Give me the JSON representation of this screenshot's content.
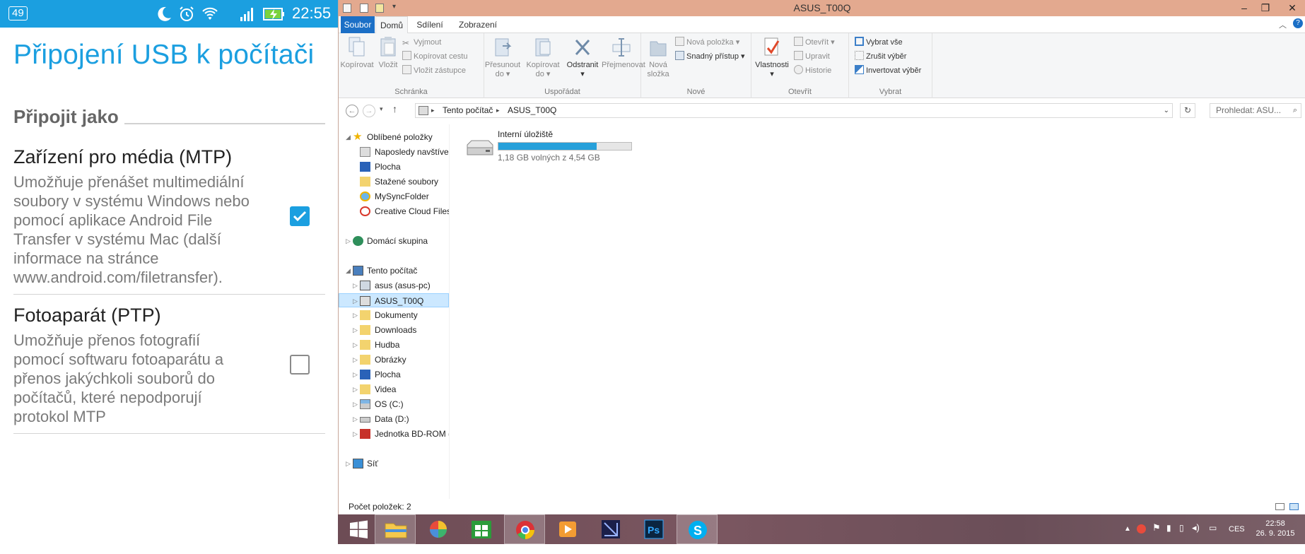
{
  "android": {
    "status_badge": "49",
    "time": "22:55",
    "title": "Připojení USB k počítači",
    "section": "Připojit jako",
    "options": [
      {
        "title": "Zařízení pro média (MTP)",
        "desc_lines": [
          "Umožňuje přenášet multimediální",
          "soubory v systému Windows nebo",
          "pomocí aplikace Android File",
          "Transfer v systému Mac (další",
          "informace na stránce",
          "www.android.com/filetransfer)."
        ],
        "checked": true
      },
      {
        "title": "Fotoaparát (PTP)",
        "desc_lines": [
          "Umožňuje přenos fotografií",
          "pomocí softwaru fotoaparátu a",
          "přenos jakýchkoli souborů do",
          "počítačů, které nepodporují",
          "protokol MTP"
        ],
        "checked": false
      }
    ],
    "colors": {
      "accent": "#1b9fe0"
    }
  },
  "explorer": {
    "window_title": "ASUS_T00Q",
    "tabs": [
      "Soubor",
      "Domů",
      "Sdílení",
      "Zobrazení"
    ],
    "ribbon": {
      "schranka": {
        "label": "Schránka",
        "copy": "Kopírovat",
        "paste": "Vložit",
        "cut": "Vyjmout",
        "copy_path": "Kopírovat cestu",
        "paste_shortcut": "Vložit zástupce"
      },
      "usporadat": {
        "label": "Uspořádat",
        "move_1": "Přesunout",
        "move_2": "do",
        "copyto_1": "Kopírovat",
        "copyto_2": "do",
        "delete": "Odstranit",
        "rename": "Přejmenovat"
      },
      "nove": {
        "label": "Nové",
        "new_folder_1": "Nová",
        "new_folder_2": "složka",
        "new_item": "Nová položka",
        "easy_access": "Snadný přístup"
      },
      "otevrit": {
        "label": "Otevřít",
        "properties": "Vlastnosti",
        "open": "Otevřít",
        "edit": "Upravit",
        "history": "Historie"
      },
      "vybrat": {
        "label": "Vybrat",
        "select_all": "Vybrat vše",
        "select_none": "Zrušit výběr",
        "invert": "Invertovat výběr"
      }
    },
    "address": {
      "part1": "Tento počítač",
      "part2": "ASUS_T00Q"
    },
    "search_placeholder": "Prohledat: ASU...",
    "nav": {
      "favorites": "Oblíbené položky",
      "fav_items": [
        "Naposledy navštíven",
        "Plocha",
        "Stažené soubory",
        "MySyncFolder",
        "Creative Cloud Files"
      ],
      "homegroup": "Domácí skupina",
      "pc": "Tento počítač",
      "pc_items": [
        "asus (asus-pc)",
        "ASUS_T00Q",
        "Dokumenty",
        "Downloads",
        "Hudba",
        "Obrázky",
        "Plocha",
        "Videa",
        "OS (C:)",
        "Data (D:)",
        "Jednotka BD-ROM (I"
      ],
      "network": "Síť"
    },
    "drive": {
      "name": "Interní úložiště",
      "free_text": "1,18 GB volných z 4,54 GB",
      "used_fraction": 0.74
    },
    "status": "Počet položek: 2"
  },
  "taskbar": {
    "lang": "CES",
    "time": "22:58",
    "date": "26. 9. 2015"
  }
}
